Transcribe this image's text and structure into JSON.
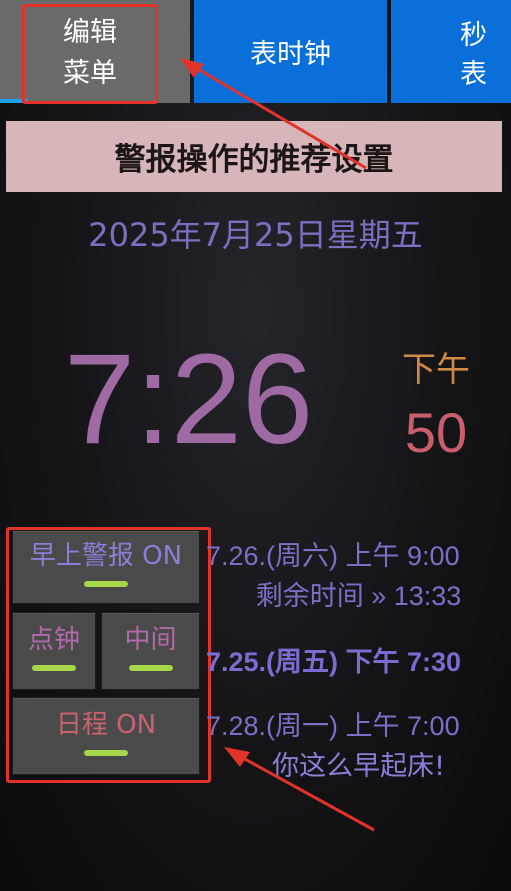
{
  "tabs": {
    "menu_line1": "编辑",
    "menu_line2": "菜单",
    "clock": "表时钟",
    "stopwatch": "秒表"
  },
  "banner": "警报操作的推荐设置",
  "clock": {
    "date": "2025年7月25日星期五",
    "time": "7:26",
    "ampm": "下午",
    "seconds": "50"
  },
  "buttons": {
    "morning_alarm": "早上警报 ON",
    "hourly_chime": "点钟",
    "middle": "中间",
    "schedule": "日程 ON"
  },
  "alarms": [
    {
      "text": "7.26.(周六) 上午 9:00"
    },
    {
      "text": "剩余时间 » 13:33"
    },
    {
      "text": "7.25.(周五) 下午 7:30"
    },
    {
      "text": "7.28.(周一) 上午 7:00"
    }
  ],
  "note": "你这么早起床!",
  "colors": {
    "highlight": "#e2332b",
    "tab_blue": "#0a6fd8",
    "toggle_on": "#a6d64a"
  }
}
